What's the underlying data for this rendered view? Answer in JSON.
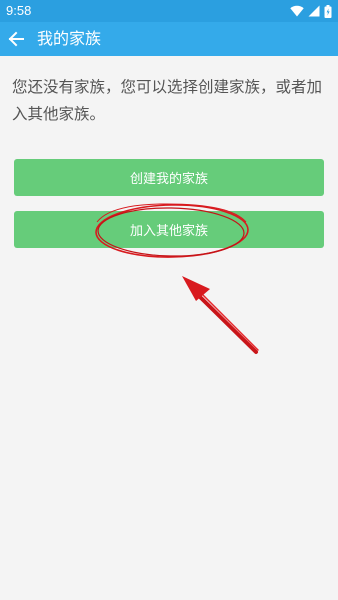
{
  "status_bar": {
    "time": "9:58",
    "icons": [
      "wifi-icon",
      "signal-icon",
      "battery-icon"
    ]
  },
  "app_bar": {
    "title": "我的家族",
    "back_icon": "arrow-left-icon"
  },
  "content": {
    "message": "您还没有家族，您可以选择创建家族，或者加入其他家族。",
    "create_button_label": "创建我的家族",
    "join_button_label": "加入其他家族"
  },
  "colors": {
    "status_bar": "#2b9fe0",
    "app_bar": "#34aaea",
    "button": "#66cc7a",
    "annotation": "#e0161b"
  },
  "annotations": [
    "red-ellipse-highlight",
    "red-arrow-pointer"
  ]
}
